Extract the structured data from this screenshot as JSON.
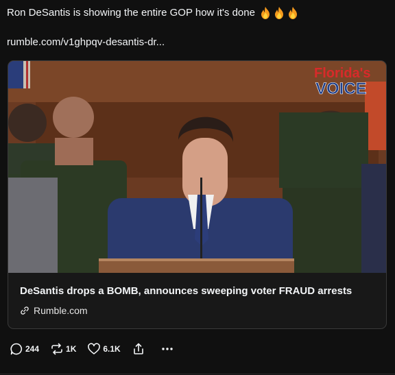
{
  "post": {
    "text": "Ron DeSantis is showing the entire GOP how it's done",
    "emoji": [
      "fire-icon",
      "fire-icon",
      "fire-icon"
    ],
    "link": "rumble.com/v1ghpqv-desantis-dr..."
  },
  "card": {
    "title": "DeSantis drops a BOMB, announces sweeping voter FRAUD arrests",
    "domain": "Rumble.com",
    "thumbnail": {
      "logo_line1": "Florida's",
      "logo_line2": "VOICE"
    }
  },
  "actions": {
    "replies": "244",
    "reposts": "1K",
    "likes": "6.1K",
    "share_icon": "share-icon",
    "more_icon": "more-icon"
  },
  "colors": {
    "background": "#101010",
    "text": "#f3f5f7",
    "card_border": "#3a3a3a"
  }
}
